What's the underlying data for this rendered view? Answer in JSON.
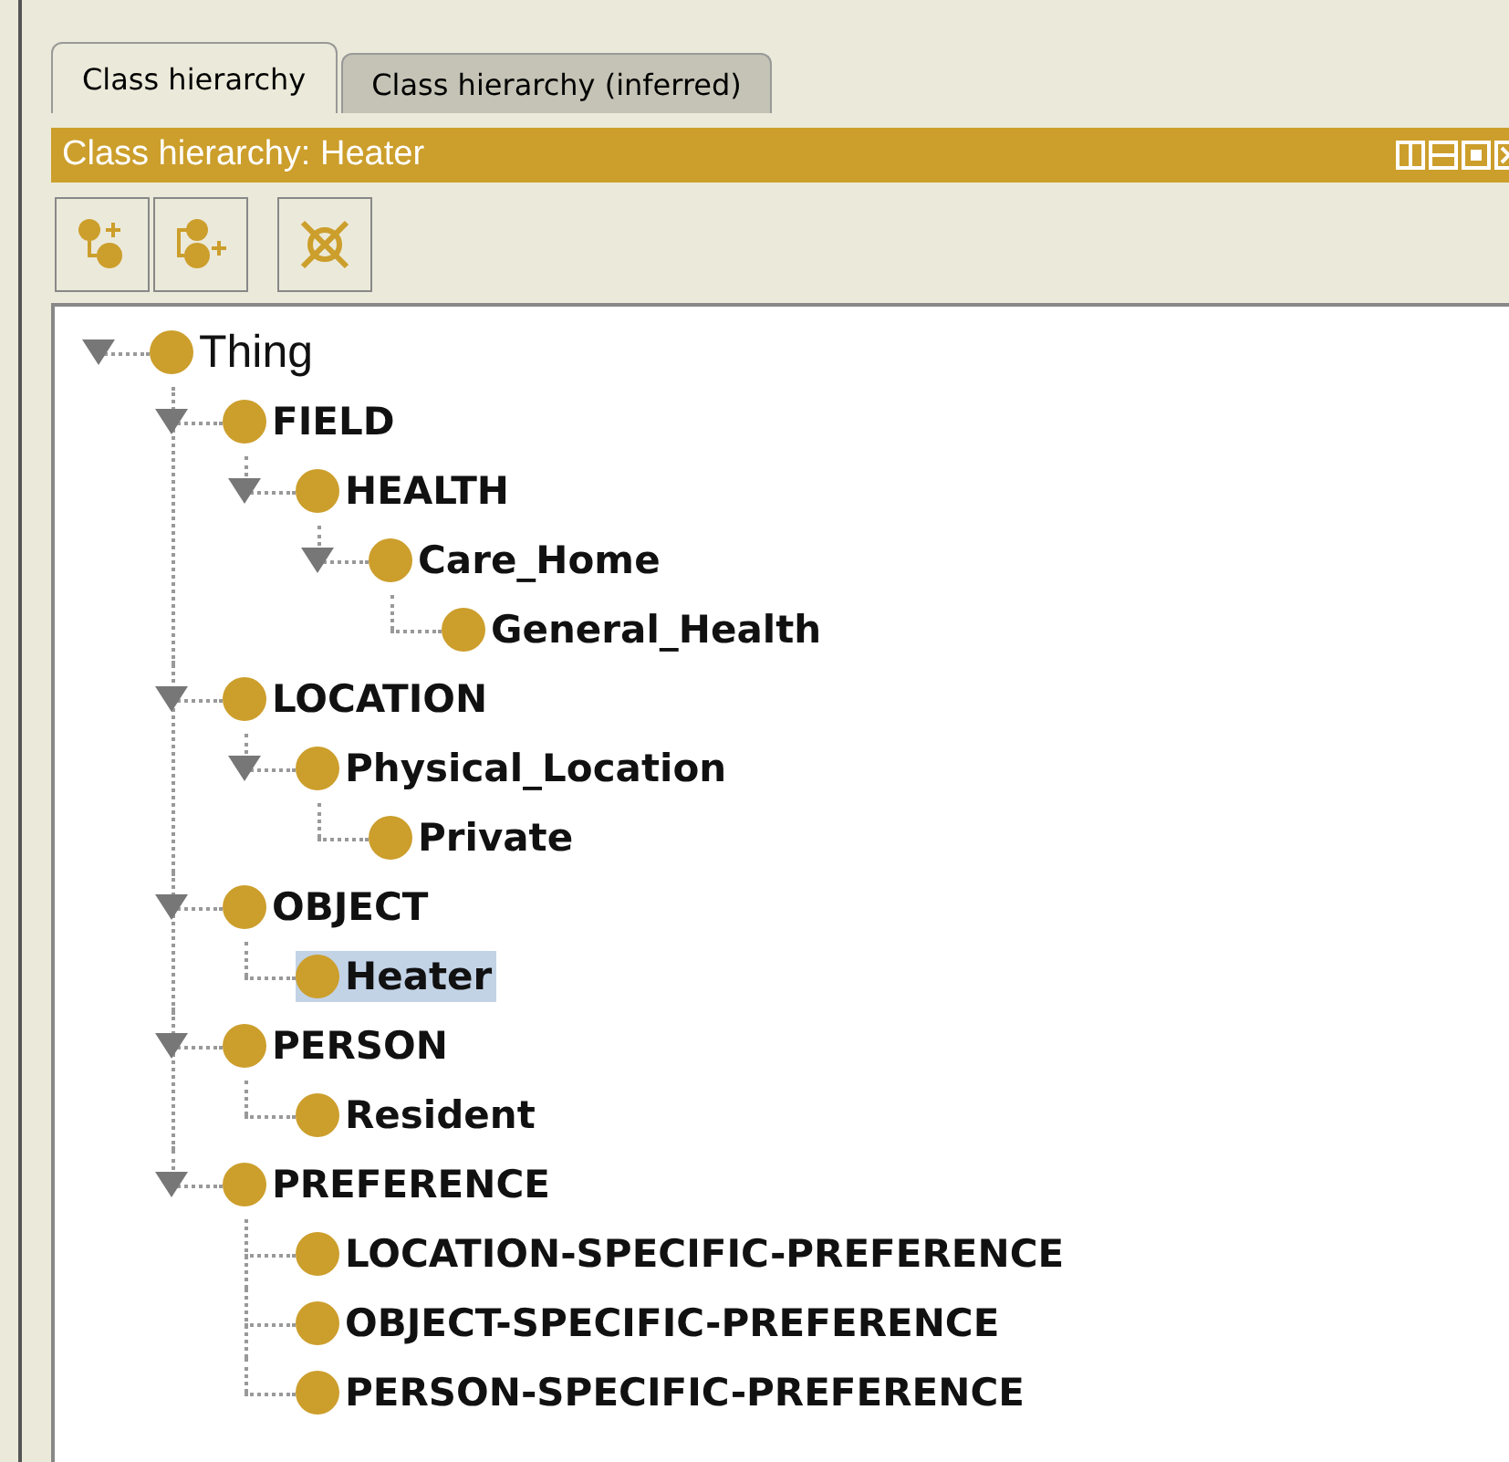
{
  "tabs": [
    {
      "label": "Class hierarchy",
      "selected": true
    },
    {
      "label": "Class hierarchy (inferred)",
      "selected": false
    }
  ],
  "view": {
    "title": "Class hierarchy: Heater"
  },
  "tree": [
    {
      "label": "Thing",
      "kind": "root",
      "expanded": true,
      "selected": false,
      "children": [
        {
          "label": "FIELD",
          "kind": "class",
          "expanded": true,
          "selected": false,
          "children": [
            {
              "label": "HEALTH",
              "kind": "class",
              "expanded": true,
              "selected": false,
              "children": [
                {
                  "label": "Care_Home",
                  "kind": "class",
                  "expanded": true,
                  "selected": false,
                  "children": [
                    {
                      "label": "General_Health",
                      "kind": "class",
                      "expanded": false,
                      "selected": false
                    }
                  ]
                }
              ]
            }
          ]
        },
        {
          "label": "LOCATION",
          "kind": "class",
          "expanded": true,
          "selected": false,
          "children": [
            {
              "label": "Physical_Location",
              "kind": "class",
              "expanded": true,
              "selected": false,
              "children": [
                {
                  "label": "Private",
                  "kind": "class",
                  "expanded": false,
                  "selected": false
                }
              ]
            }
          ]
        },
        {
          "label": "OBJECT",
          "kind": "class",
          "expanded": true,
          "selected": false,
          "children": [
            {
              "label": "Heater",
              "kind": "class",
              "expanded": false,
              "selected": true
            }
          ]
        },
        {
          "label": "PERSON",
          "kind": "class",
          "expanded": true,
          "selected": false,
          "children": [
            {
              "label": "Resident",
              "kind": "class",
              "expanded": false,
              "selected": false
            }
          ]
        },
        {
          "label": "PREFERENCE",
          "kind": "class",
          "expanded": true,
          "selected": false,
          "children": [
            {
              "label": "LOCATION-SPECIFIC-PREFERENCE",
              "kind": "class",
              "expanded": false,
              "selected": false
            },
            {
              "label": "OBJECT-SPECIFIC-PREFERENCE",
              "kind": "class",
              "expanded": false,
              "selected": false
            },
            {
              "label": "PERSON-SPECIFIC-PREFERENCE",
              "kind": "class",
              "expanded": false,
              "selected": false
            }
          ]
        }
      ]
    }
  ]
}
